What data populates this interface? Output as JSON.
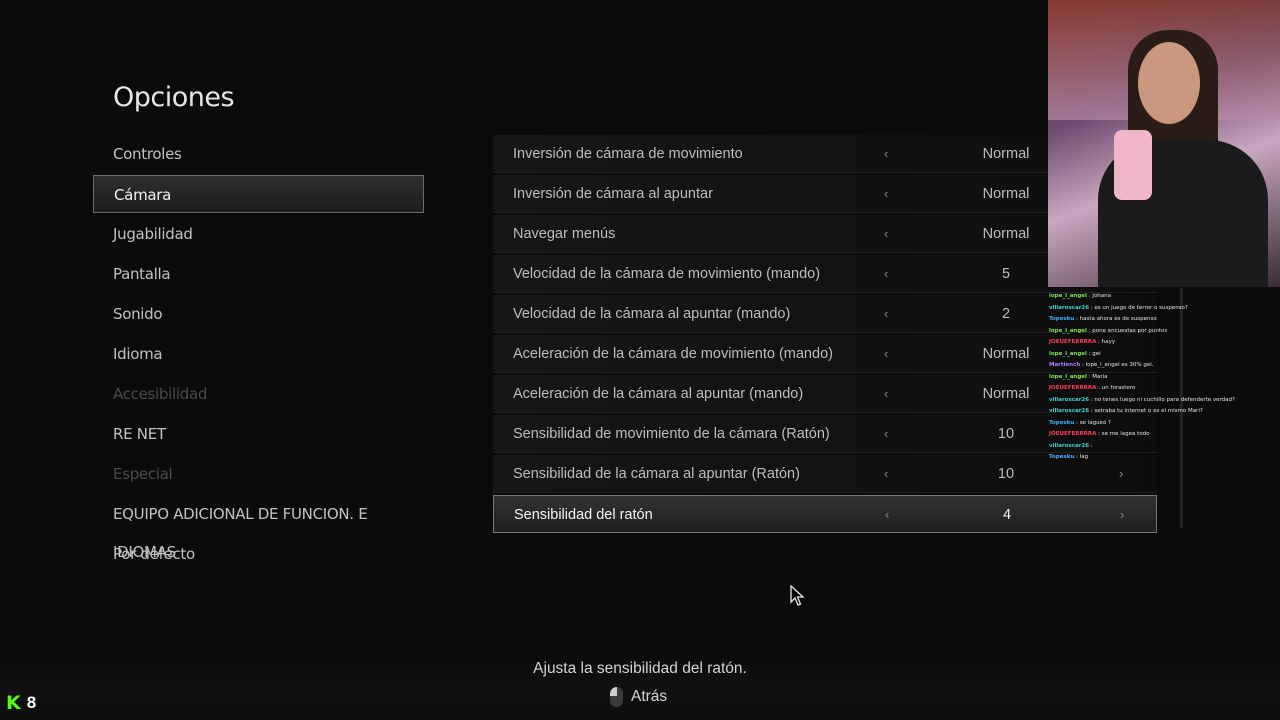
{
  "page": {
    "title": "Opciones"
  },
  "menu": [
    {
      "label": "Controles",
      "state": "normal"
    },
    {
      "label": "Cámara",
      "state": "selected"
    },
    {
      "label": "Jugabilidad",
      "state": "normal"
    },
    {
      "label": "Pantalla",
      "state": "normal"
    },
    {
      "label": "Sonido",
      "state": "normal"
    },
    {
      "label": "Idioma",
      "state": "normal"
    },
    {
      "label": "Accesibilidad",
      "state": "disabled"
    },
    {
      "label": "RE NET",
      "state": "normal"
    },
    {
      "label": "Especial",
      "state": "disabled"
    },
    {
      "label": "EQUIPO ADICIONAL DE FUNCION. E IDIOMAS",
      "state": "normal"
    },
    {
      "label": "Por defecto",
      "state": "normal"
    }
  ],
  "settings": [
    {
      "label": "Inversión de cámara de movimiento",
      "value": "Normal",
      "left_arrow": "‹",
      "right_arrow": ""
    },
    {
      "label": "Inversión de cámara al apuntar",
      "value": "Normal",
      "left_arrow": "‹",
      "right_arrow": ""
    },
    {
      "label": "Navegar menús",
      "value": "Normal",
      "left_arrow": "‹",
      "right_arrow": ""
    },
    {
      "label": "Velocidad de la cámara de movimiento (mando)",
      "value": "5",
      "left_arrow": "‹",
      "right_arrow": ""
    },
    {
      "label": "Velocidad de la cámara al apuntar (mando)",
      "value": "2",
      "left_arrow": "‹",
      "right_arrow": ""
    },
    {
      "label": "Aceleración de la cámara de movimiento (mando)",
      "value": "Normal",
      "left_arrow": "‹",
      "right_arrow": ""
    },
    {
      "label": "Aceleración de la cámara al apuntar (mando)",
      "value": "Normal",
      "left_arrow": "‹",
      "right_arrow": ""
    },
    {
      "label": "Sensibilidad de movimiento de la cámara (Ratón)",
      "value": "10",
      "left_arrow": "‹",
      "right_arrow": ""
    },
    {
      "label": "Sensibilidad de la cámara al apuntar (Ratón)",
      "value": "10",
      "left_arrow": "‹",
      "right_arrow": "›"
    },
    {
      "label": "Sensibilidad del ratón",
      "value": "4",
      "left_arrow": "‹",
      "right_arrow": "›"
    }
  ],
  "footer": {
    "description": "Ajusta la sensibilidad del ratón.",
    "back_label": "Atrás",
    "back_icon": "mouse-right-click-icon"
  },
  "chat": [
    {
      "user": "lope_l_angel",
      "color": "#7fe05a",
      "message": "Johana"
    },
    {
      "user": "villaroscar26",
      "color": "#3fd2c8",
      "message": "es un juego de terror o suspenso?"
    },
    {
      "user": "Topesku",
      "color": "#4aa8ff",
      "message": "hasta ahora es de suspenso"
    },
    {
      "user": "lope_l_angel",
      "color": "#7fe05a",
      "message": "pone encuestas por puntos"
    },
    {
      "user": "JOEUEFERRRRA",
      "color": "#ff3b5c",
      "message": "hayy"
    },
    {
      "user": "lope_l_angel",
      "color": "#7fe05a",
      "message": "gei"
    },
    {
      "user": "Martiench",
      "color": "#b07cff",
      "message": "lope_l_angel es 30% gei."
    },
    {
      "user": "lope_l_angel",
      "color": "#7fe05a",
      "message": "Maria"
    },
    {
      "user": "JOEUEFERRRRA",
      "color": "#ff3b5c",
      "message": "un forastero"
    },
    {
      "user": "villaroscar26",
      "color": "#3fd2c8",
      "message": "no tenes luego ni cuchillo para defenderte verdad?"
    },
    {
      "user": "villaroscar26",
      "color": "#3fd2c8",
      "message": "setraba tu internet o es el mismo Mari?"
    },
    {
      "user": "Topesku",
      "color": "#4aa8ff",
      "message": "se lagueó ?"
    },
    {
      "user": "JOEUEFERRRRA",
      "color": "#ff3b5c",
      "message": "se me lagea todo"
    },
    {
      "user": "villaroscar26",
      "color": "#3fd2c8",
      "message": ""
    },
    {
      "user": "Topesku",
      "color": "#4aa8ff",
      "message": "lag"
    }
  ],
  "badge": {
    "icon": "kick-logo-icon",
    "letter": "K",
    "count": "8"
  },
  "colors": {
    "accent_green": "#53fc18",
    "selected_border": "#6b6b6b"
  }
}
